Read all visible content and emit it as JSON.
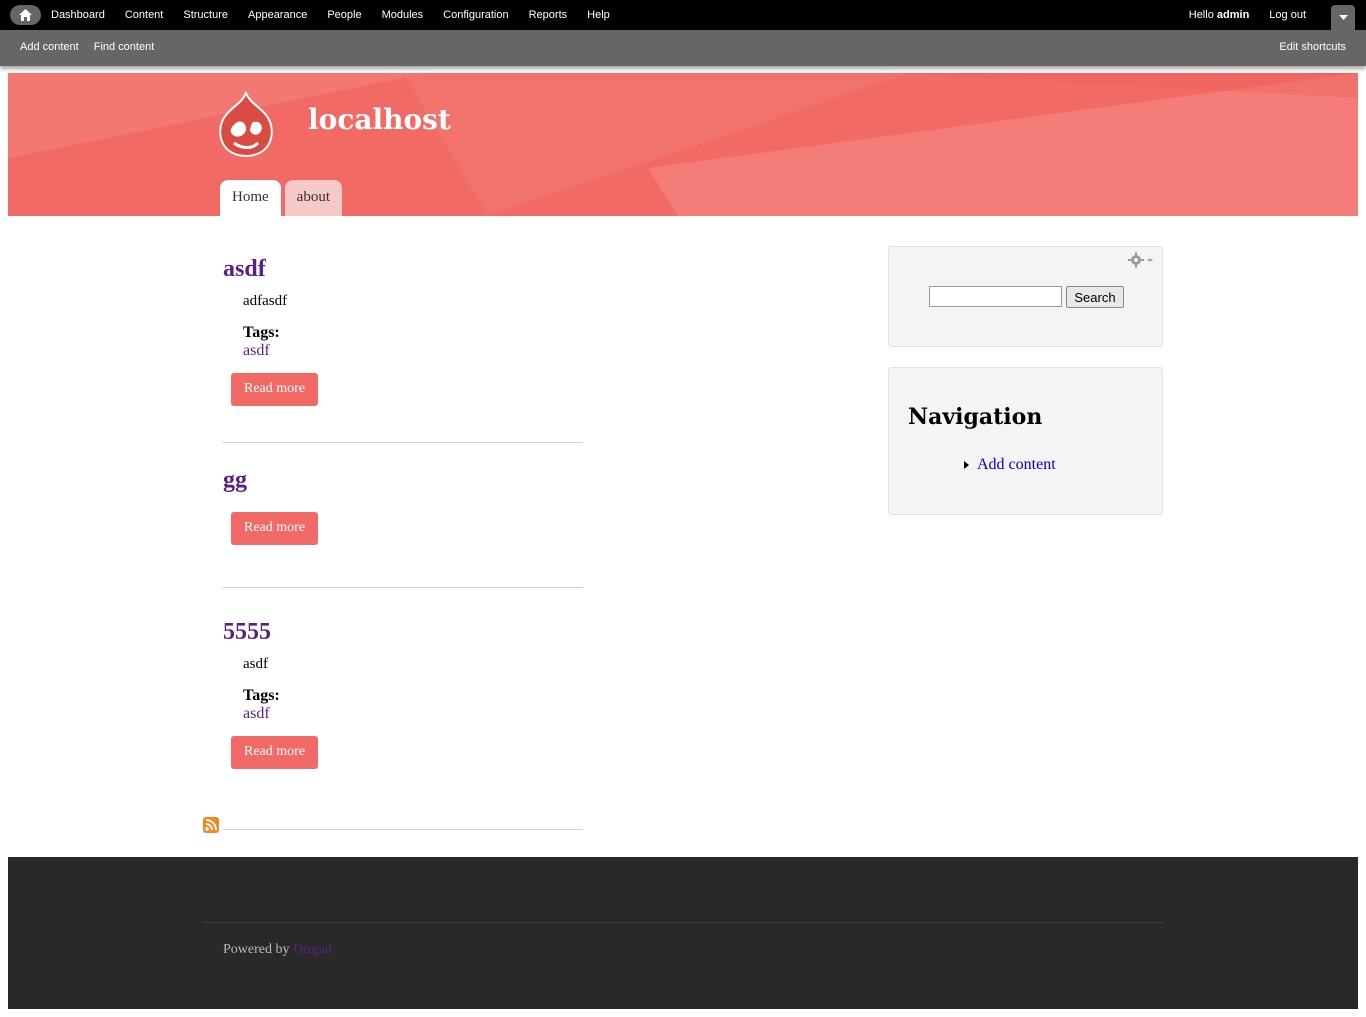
{
  "toolbar": {
    "menu": [
      "Dashboard",
      "Content",
      "Structure",
      "Appearance",
      "People",
      "Modules",
      "Configuration",
      "Reports",
      "Help"
    ],
    "hello_prefix": "Hello",
    "username": "admin",
    "logout": "Log out"
  },
  "shortcuts": {
    "items": [
      "Add content",
      "Find content"
    ],
    "edit": "Edit shortcuts"
  },
  "header": {
    "site_name": "localhost",
    "brand_color": "#f26a66",
    "tabs": [
      {
        "label": "Home",
        "active": true
      },
      {
        "label": "about",
        "active": false
      }
    ]
  },
  "nodes": [
    {
      "title": "asdf",
      "body": "adfasdf",
      "tags_label": "Tags:",
      "tag": "asdf",
      "read_more": "Read more"
    },
    {
      "title": "gg",
      "read_more": "Read more"
    },
    {
      "title": "5555",
      "body": "asdf",
      "tags_label": "Tags:",
      "tag": "asdf",
      "read_more": "Read more"
    }
  ],
  "sidebar": {
    "search": {
      "input_value": "",
      "button": "Search"
    },
    "navigation": {
      "title": "Navigation",
      "items": [
        "Add content"
      ]
    }
  },
  "footer": {
    "powered_by": "Powered by",
    "link": "Drupal"
  }
}
